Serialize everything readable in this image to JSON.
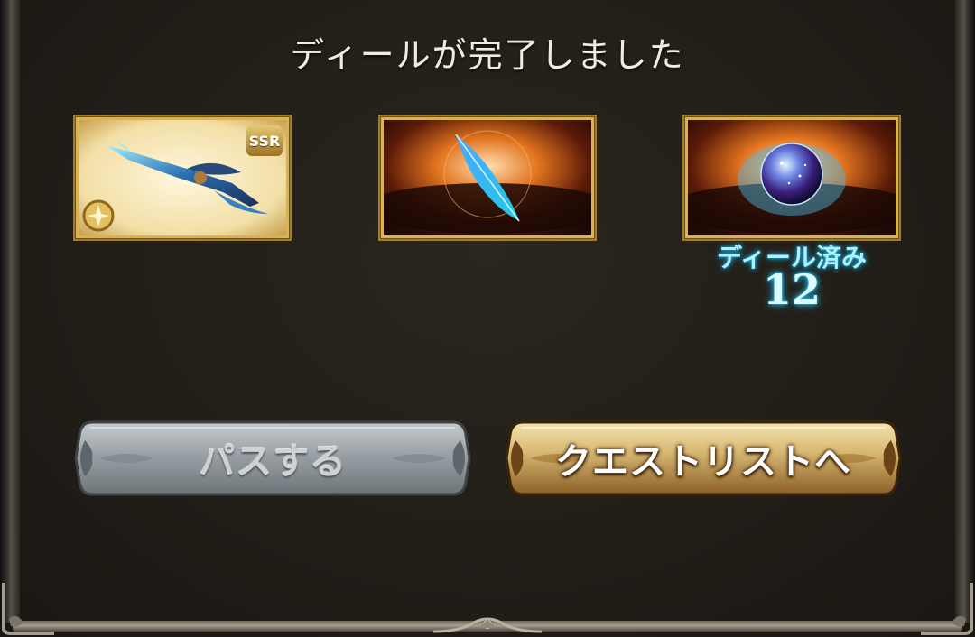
{
  "dialog": {
    "title": "ディールが完了しました"
  },
  "rewards": [
    {
      "name": "weapon-card",
      "badge": "SSR",
      "icon": "ssr-weapon-spear"
    },
    {
      "name": "feather-card",
      "icon": "blue-feather"
    },
    {
      "name": "orb-card",
      "icon": "cosmic-orb"
    }
  ],
  "dealt": {
    "label": "ディール済み",
    "count": "12"
  },
  "buttons": {
    "pass_label": "パスする",
    "quest_label": "クエストリストへ"
  },
  "colors": {
    "background": "#221e18",
    "gold_border": "#d9b255",
    "dealt_text": "#aef1ff",
    "pass_button": "#8a9196",
    "quest_button": "#d6b773"
  }
}
